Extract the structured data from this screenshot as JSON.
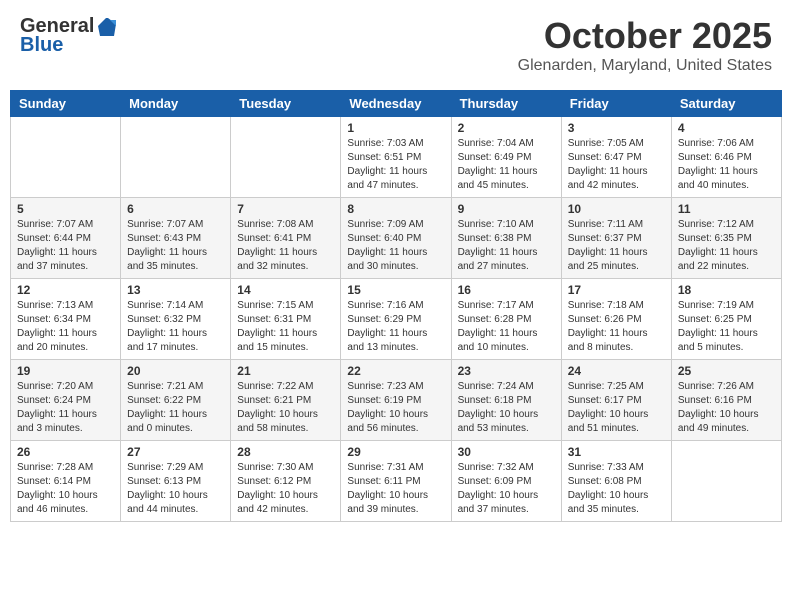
{
  "header": {
    "logo_general": "General",
    "logo_blue": "Blue",
    "month_title": "October 2025",
    "location": "Glenarden, Maryland, United States"
  },
  "days_of_week": [
    "Sunday",
    "Monday",
    "Tuesday",
    "Wednesday",
    "Thursday",
    "Friday",
    "Saturday"
  ],
  "weeks": [
    [
      {
        "day": "",
        "info": ""
      },
      {
        "day": "",
        "info": ""
      },
      {
        "day": "",
        "info": ""
      },
      {
        "day": "1",
        "info": "Sunrise: 7:03 AM\nSunset: 6:51 PM\nDaylight: 11 hours\nand 47 minutes."
      },
      {
        "day": "2",
        "info": "Sunrise: 7:04 AM\nSunset: 6:49 PM\nDaylight: 11 hours\nand 45 minutes."
      },
      {
        "day": "3",
        "info": "Sunrise: 7:05 AM\nSunset: 6:47 PM\nDaylight: 11 hours\nand 42 minutes."
      },
      {
        "day": "4",
        "info": "Sunrise: 7:06 AM\nSunset: 6:46 PM\nDaylight: 11 hours\nand 40 minutes."
      }
    ],
    [
      {
        "day": "5",
        "info": "Sunrise: 7:07 AM\nSunset: 6:44 PM\nDaylight: 11 hours\nand 37 minutes."
      },
      {
        "day": "6",
        "info": "Sunrise: 7:07 AM\nSunset: 6:43 PM\nDaylight: 11 hours\nand 35 minutes."
      },
      {
        "day": "7",
        "info": "Sunrise: 7:08 AM\nSunset: 6:41 PM\nDaylight: 11 hours\nand 32 minutes."
      },
      {
        "day": "8",
        "info": "Sunrise: 7:09 AM\nSunset: 6:40 PM\nDaylight: 11 hours\nand 30 minutes."
      },
      {
        "day": "9",
        "info": "Sunrise: 7:10 AM\nSunset: 6:38 PM\nDaylight: 11 hours\nand 27 minutes."
      },
      {
        "day": "10",
        "info": "Sunrise: 7:11 AM\nSunset: 6:37 PM\nDaylight: 11 hours\nand 25 minutes."
      },
      {
        "day": "11",
        "info": "Sunrise: 7:12 AM\nSunset: 6:35 PM\nDaylight: 11 hours\nand 22 minutes."
      }
    ],
    [
      {
        "day": "12",
        "info": "Sunrise: 7:13 AM\nSunset: 6:34 PM\nDaylight: 11 hours\nand 20 minutes."
      },
      {
        "day": "13",
        "info": "Sunrise: 7:14 AM\nSunset: 6:32 PM\nDaylight: 11 hours\nand 17 minutes."
      },
      {
        "day": "14",
        "info": "Sunrise: 7:15 AM\nSunset: 6:31 PM\nDaylight: 11 hours\nand 15 minutes."
      },
      {
        "day": "15",
        "info": "Sunrise: 7:16 AM\nSunset: 6:29 PM\nDaylight: 11 hours\nand 13 minutes."
      },
      {
        "day": "16",
        "info": "Sunrise: 7:17 AM\nSunset: 6:28 PM\nDaylight: 11 hours\nand 10 minutes."
      },
      {
        "day": "17",
        "info": "Sunrise: 7:18 AM\nSunset: 6:26 PM\nDaylight: 11 hours\nand 8 minutes."
      },
      {
        "day": "18",
        "info": "Sunrise: 7:19 AM\nSunset: 6:25 PM\nDaylight: 11 hours\nand 5 minutes."
      }
    ],
    [
      {
        "day": "19",
        "info": "Sunrise: 7:20 AM\nSunset: 6:24 PM\nDaylight: 11 hours\nand 3 minutes."
      },
      {
        "day": "20",
        "info": "Sunrise: 7:21 AM\nSunset: 6:22 PM\nDaylight: 11 hours\nand 0 minutes."
      },
      {
        "day": "21",
        "info": "Sunrise: 7:22 AM\nSunset: 6:21 PM\nDaylight: 10 hours\nand 58 minutes."
      },
      {
        "day": "22",
        "info": "Sunrise: 7:23 AM\nSunset: 6:19 PM\nDaylight: 10 hours\nand 56 minutes."
      },
      {
        "day": "23",
        "info": "Sunrise: 7:24 AM\nSunset: 6:18 PM\nDaylight: 10 hours\nand 53 minutes."
      },
      {
        "day": "24",
        "info": "Sunrise: 7:25 AM\nSunset: 6:17 PM\nDaylight: 10 hours\nand 51 minutes."
      },
      {
        "day": "25",
        "info": "Sunrise: 7:26 AM\nSunset: 6:16 PM\nDaylight: 10 hours\nand 49 minutes."
      }
    ],
    [
      {
        "day": "26",
        "info": "Sunrise: 7:28 AM\nSunset: 6:14 PM\nDaylight: 10 hours\nand 46 minutes."
      },
      {
        "day": "27",
        "info": "Sunrise: 7:29 AM\nSunset: 6:13 PM\nDaylight: 10 hours\nand 44 minutes."
      },
      {
        "day": "28",
        "info": "Sunrise: 7:30 AM\nSunset: 6:12 PM\nDaylight: 10 hours\nand 42 minutes."
      },
      {
        "day": "29",
        "info": "Sunrise: 7:31 AM\nSunset: 6:11 PM\nDaylight: 10 hours\nand 39 minutes."
      },
      {
        "day": "30",
        "info": "Sunrise: 7:32 AM\nSunset: 6:09 PM\nDaylight: 10 hours\nand 37 minutes."
      },
      {
        "day": "31",
        "info": "Sunrise: 7:33 AM\nSunset: 6:08 PM\nDaylight: 10 hours\nand 35 minutes."
      },
      {
        "day": "",
        "info": ""
      }
    ]
  ]
}
